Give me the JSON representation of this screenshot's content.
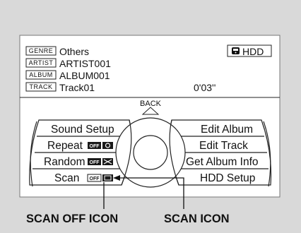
{
  "screen": {
    "info": {
      "rows": [
        {
          "tag": "GENRE",
          "value": "Others"
        },
        {
          "tag": "ARTIST",
          "value": "ARTIST001"
        },
        {
          "tag": "ALBUM",
          "value": "ALBUM001"
        },
        {
          "tag": "TRACK",
          "value": "Track01"
        }
      ],
      "time": "0'03''",
      "source": "HDD",
      "source_icon": "hdd-icon"
    },
    "back_label": "BACK",
    "menu": {
      "left": [
        {
          "label": "Sound Setup"
        },
        {
          "label": "Repeat",
          "badge_off": "OFF"
        },
        {
          "label": "Random",
          "badge_off": "OFF"
        },
        {
          "label": "Scan",
          "badge_off": "OFF"
        }
      ],
      "right": [
        {
          "label": "Edit Album"
        },
        {
          "label": "Edit Track"
        },
        {
          "label": "Get Album Info"
        },
        {
          "label": "HDD Setup"
        }
      ]
    }
  },
  "callouts": {
    "scan_off_icon": "SCAN OFF ICON",
    "scan_icon": "SCAN ICON"
  },
  "colors": {
    "background": "#d9d9d9",
    "screen": "#ffffff",
    "badge": "#1a1a1a",
    "line": "#111111"
  }
}
